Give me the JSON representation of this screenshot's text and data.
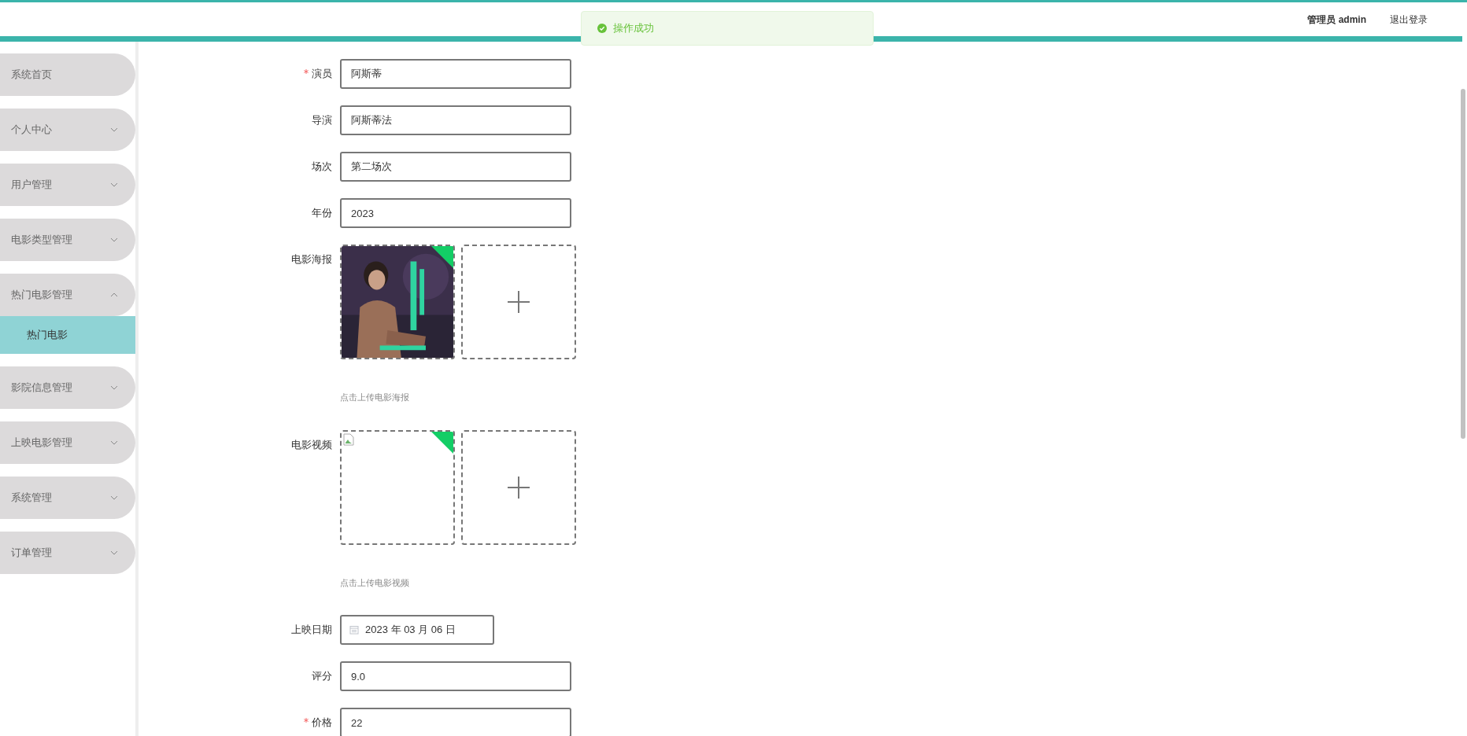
{
  "header": {
    "user": "管理员 admin",
    "logout": "退出登录"
  },
  "toast": {
    "message": "操作成功"
  },
  "sidebar": {
    "items": [
      {
        "kind": "link",
        "label": "系统首页"
      },
      {
        "kind": "menu",
        "label": "个人中心",
        "expanded": false
      },
      {
        "kind": "menu",
        "label": "用户管理",
        "expanded": false
      },
      {
        "kind": "menu",
        "label": "电影类型管理",
        "expanded": false
      },
      {
        "kind": "menu",
        "label": "热门电影管理",
        "expanded": true,
        "children": [
          {
            "label": "热门电影",
            "selected": true
          }
        ]
      },
      {
        "kind": "menu",
        "label": "影院信息管理",
        "expanded": false
      },
      {
        "kind": "menu",
        "label": "上映电影管理",
        "expanded": false
      },
      {
        "kind": "menu",
        "label": "系统管理",
        "expanded": false
      },
      {
        "kind": "menu",
        "label": "订单管理",
        "expanded": false
      }
    ]
  },
  "form": {
    "fields": [
      {
        "kind": "text",
        "label": "演员",
        "required": true,
        "value": "阿斯蒂"
      },
      {
        "kind": "text",
        "label": "导演",
        "required": false,
        "value": "阿斯蒂法"
      },
      {
        "kind": "text",
        "label": "场次",
        "required": false,
        "value": "第二场次"
      },
      {
        "kind": "text",
        "label": "年份",
        "required": false,
        "value": "2023"
      },
      {
        "kind": "upload",
        "label": "电影海报",
        "required": false,
        "broken_image": false,
        "hint": "点击上传电影海报"
      },
      {
        "kind": "upload",
        "label": "电影视频",
        "required": false,
        "broken_image": true,
        "hint": "点击上传电影视频"
      },
      {
        "kind": "date",
        "label": "上映日期",
        "required": false,
        "value": "2023 年 03 月 06 日"
      },
      {
        "kind": "text",
        "label": "评分",
        "required": false,
        "value": "9.0"
      },
      {
        "kind": "text",
        "label": "价格",
        "required": true,
        "value": "22"
      }
    ]
  }
}
